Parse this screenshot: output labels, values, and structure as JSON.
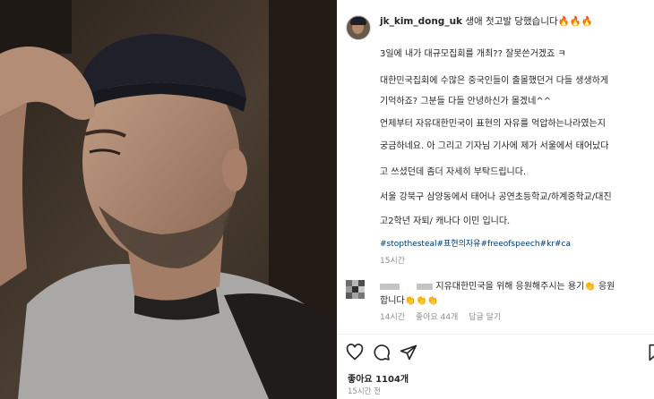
{
  "post": {
    "username": "jk_kim_dong_uk",
    "caption_first": "생애 첫고발 당했습니다🔥🔥🔥",
    "caption_lines": [
      "3일에 내가 대규모집회를 개최?? 잘못쓴거겠죠 ㅋ",
      "대한민국집회에 수많은 중국인들이 출몰했던거 다들 생생하게",
      "기억하죠? 그분들 다들 안녕하신가 몰겠네^^",
      "언제부터 자유대한민국이 표현의 자유를 억압하는나라였는지",
      "궁금하네요. 아 그리고 기자님 기사에 제가 서울에서 태어났다",
      "고 쓰셨던데 좀더 자세히 부탁드립니다.",
      "서울 강북구 삼양동에서 태어나 공연초등학교/하계중학교/대진",
      "고2학년 자퇴/ 캐나다 이민 입니다."
    ],
    "hashtags": "#stopthesteal#표현의자유#freeofspeech#kr#ca",
    "timestamp": "15시간"
  },
  "comment": {
    "text_line1": "지유대한민국을 위해 응원해주시는 용기👏 응원",
    "text_line2": "합니다👏👏👏",
    "time": "14시간",
    "likes": "좋아요 44개",
    "reply": "답글 달기"
  },
  "footer": {
    "likes": "좋아요 1104개",
    "time_ago": "15시간 전"
  },
  "icons": [
    "heart-icon",
    "comment-icon",
    "share-icon",
    "bookmark-icon"
  ],
  "colors": {
    "hashtag": "#00376b",
    "muted": "#8e8e8e",
    "text": "#262626"
  }
}
